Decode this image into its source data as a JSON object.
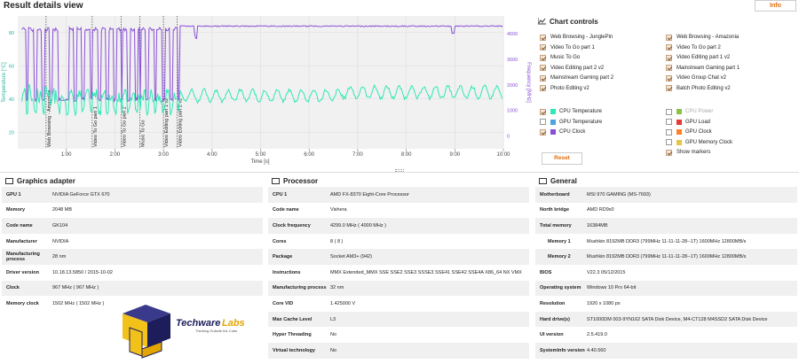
{
  "header": {
    "title": "Result details view",
    "info_label": "Info"
  },
  "chart_data": {
    "type": "line",
    "xlabel": "Time [s]",
    "ylabel_left": "Temperature [°C]",
    "ylabel_right": "Frequency [MHz]",
    "x_ticks": [
      "1:00",
      "2:00",
      "3:00",
      "4:00",
      "5:00",
      "6:00",
      "7:00",
      "8:00",
      "9:00",
      "10:00"
    ],
    "y_left_ticks": [
      "20",
      "40",
      "60",
      "80"
    ],
    "y_right_ticks": [
      "0",
      "1000",
      "2000",
      "3000",
      "4000"
    ],
    "y_left_range": [
      10,
      90
    ],
    "y_right_range": [
      -500,
      4700
    ],
    "x_range_seconds": [
      0,
      600
    ],
    "markers": [
      {
        "time": 35,
        "label": "Web Browsing - Amazonia"
      },
      {
        "time": 92,
        "label": "Video To Go part 1"
      },
      {
        "time": 128,
        "label": "Video To Go part 2"
      },
      {
        "time": 151,
        "label": "Music To Go"
      },
      {
        "time": 180,
        "label": "Video Editing part 1 v2"
      },
      {
        "time": 197,
        "label": "Video Editing part 2 v2"
      }
    ],
    "series": [
      {
        "name": "CPU Temperature",
        "color": "#2ee8b5"
      },
      {
        "name": "CPU Clock",
        "color": "#8a4fd6"
      }
    ]
  },
  "controls": {
    "title": "Chart controls",
    "workloads_left": [
      {
        "label": "Web Browsing - JunglePin",
        "checked": true
      },
      {
        "label": "Video To Go part 1",
        "checked": true
      },
      {
        "label": "Music To Go",
        "checked": true
      },
      {
        "label": "Video Editing part 2 v2",
        "checked": true
      },
      {
        "label": "Mainstream Gaming part 2",
        "checked": true
      },
      {
        "label": "Photo Editing v2",
        "checked": true
      }
    ],
    "workloads_right": [
      {
        "label": "Web Browsing - Amazonia",
        "checked": true
      },
      {
        "label": "Video To Go part 2",
        "checked": true
      },
      {
        "label": "Video Editing part 1 v2",
        "checked": true
      },
      {
        "label": "Mainstream Gaming part 1",
        "checked": true
      },
      {
        "label": "Video Group Chat v2",
        "checked": true
      },
      {
        "label": "Batch Photo Editing v2",
        "checked": true
      }
    ],
    "metrics_left": [
      {
        "label": "CPU Temperature",
        "checked": true,
        "color": "#2ee8b5"
      },
      {
        "label": "GPU Temperature",
        "checked": false,
        "color": "#4aa3e0"
      },
      {
        "label": "CPU Clock",
        "checked": true,
        "color": "#8a4fd6"
      }
    ],
    "metrics_right": [
      {
        "label": "CPU Power",
        "checked": false,
        "color": "#8bc34a",
        "dim": true
      },
      {
        "label": "GPU Load",
        "checked": false,
        "color": "#e53935"
      },
      {
        "label": "GPU Clock",
        "checked": false,
        "color": "#ff7f27"
      },
      {
        "label": "GPU Memory Clock",
        "checked": false,
        "color": "#e8c547"
      },
      {
        "label": "Show markers",
        "checked": true
      }
    ],
    "reset_label": "Reset"
  },
  "graphics": {
    "title": "Graphics adapter",
    "rows": [
      {
        "key": "GPU 1",
        "value": "NVIDIA GeForce GTX 670"
      },
      {
        "key": "Memory",
        "value": "2048 MB"
      },
      {
        "key": "Code name",
        "value": "GK104"
      },
      {
        "key": "Manufacturer",
        "value": "NVIDIA"
      },
      {
        "key": "Manufacturing process",
        "value": "28 nm"
      },
      {
        "key": "Driver version",
        "value": "10.18.13.5850 / 2015-10-02"
      },
      {
        "key": "Clock",
        "value": "967 MHz ( 967 MHz )"
      },
      {
        "key": "Memory clock",
        "value": "1502 MHz ( 1502 MHz )"
      }
    ]
  },
  "processor": {
    "title": "Processor",
    "rows": [
      {
        "key": "CPU 1",
        "value": "AMD FX-8370 Eight-Core Processor"
      },
      {
        "key": "Code name",
        "value": "Vishera"
      },
      {
        "key": "Clock frequency",
        "value": "4299.0 MHz ( 4000 MHz )"
      },
      {
        "key": "Cores",
        "value": "8 ( 8 )"
      },
      {
        "key": "Package",
        "value": "Socket AM3+ (942)"
      },
      {
        "key": "Instructions",
        "value": "MMX Extended_MMX SSE SSE2 SSE3 SSSE3 SSE41 SSE42 SSE4A X86_64 NX VMX"
      },
      {
        "key": "Manufacturing process",
        "value": "32 nm"
      },
      {
        "key": "Core VID",
        "value": "1.425000 V"
      },
      {
        "key": "Max Cache Level",
        "value": "L3"
      },
      {
        "key": "Hyper Threading",
        "value": "No"
      },
      {
        "key": "Virtual technology",
        "value": "No"
      }
    ]
  },
  "general": {
    "title": "General",
    "rows": [
      {
        "key": "Motherboard",
        "value": "MSI 970 GAMING (MS-7693)"
      },
      {
        "key": "North bridge",
        "value": "AMD RD9x0"
      },
      {
        "key": "Total memory",
        "value": "16384MB"
      },
      {
        "key": "Memory 1",
        "value": "Mushkin 8192MB DDR3 (799MHz 11-11-11-28--1T) 1600MHz 12800MB/s",
        "sub": true
      },
      {
        "key": "Memory 2",
        "value": "Mushkin 8192MB DDR3 (799MHz 11-11-11-28--1T) 1600MHz 12800MB/s",
        "sub": true
      },
      {
        "key": "BIOS",
        "value": "V22.3 05/12/2015"
      },
      {
        "key": "Operating system",
        "value": "Windows 10 Pro 64-bit"
      },
      {
        "key": "Resolution",
        "value": "1920 x 1080 px"
      },
      {
        "key": "Hard drive(s)",
        "value": "ST1000DM 003-9YN162 SATA Disk Device, M4-CT128 M4SSD2 SATA Disk Device"
      },
      {
        "key": "UI version",
        "value": "2.5.419.0"
      },
      {
        "key": "SystemInfo version",
        "value": "4.40.560"
      }
    ]
  },
  "logo": {
    "name": "TechwareLabs",
    "tagline": "Thinking Outside the Cube"
  }
}
